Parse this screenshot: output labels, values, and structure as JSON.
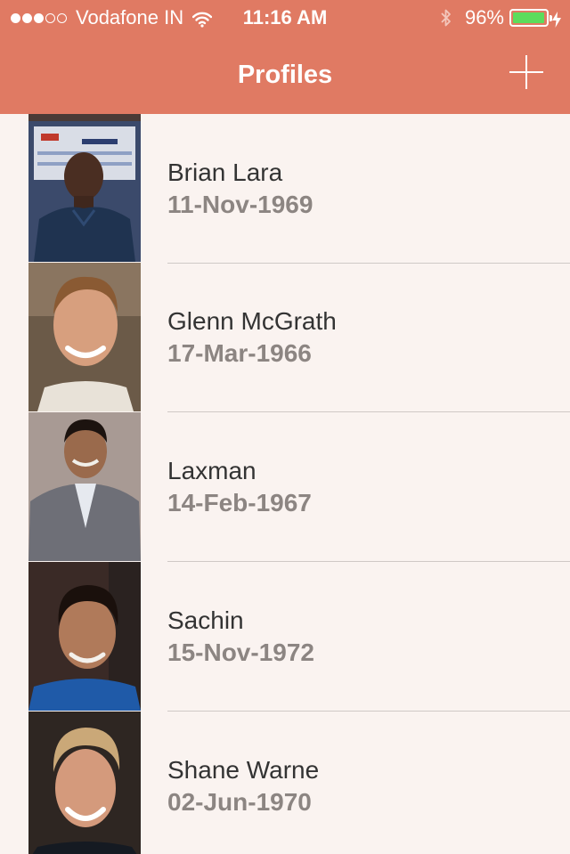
{
  "status_bar": {
    "carrier": "Vodafone IN",
    "time": "11:16 AM",
    "battery_percent": "96%",
    "battery_level": 0.96,
    "signal_bars_filled": 3,
    "signal_bars_total": 5,
    "icons": [
      "signal-dots",
      "wifi-icon",
      "bluetooth-icon",
      "battery-icon",
      "charging-icon"
    ]
  },
  "nav": {
    "title": "Profiles",
    "add_icon": "plus-icon"
  },
  "colors": {
    "header": "#e07a63",
    "background": "#faf3f0",
    "name_text": "#333333",
    "date_text": "#8c8582",
    "battery_fill": "#5cdc5c"
  },
  "profiles": [
    {
      "name": "Brian Lara",
      "dob": "11-Nov-1969"
    },
    {
      "name": "Glenn McGrath",
      "dob": "17-Mar-1966"
    },
    {
      "name": "Laxman",
      "dob": "14-Feb-1967"
    },
    {
      "name": "Sachin",
      "dob": "15-Nov-1972"
    },
    {
      "name": "Shane Warne",
      "dob": "02-Jun-1970"
    }
  ]
}
